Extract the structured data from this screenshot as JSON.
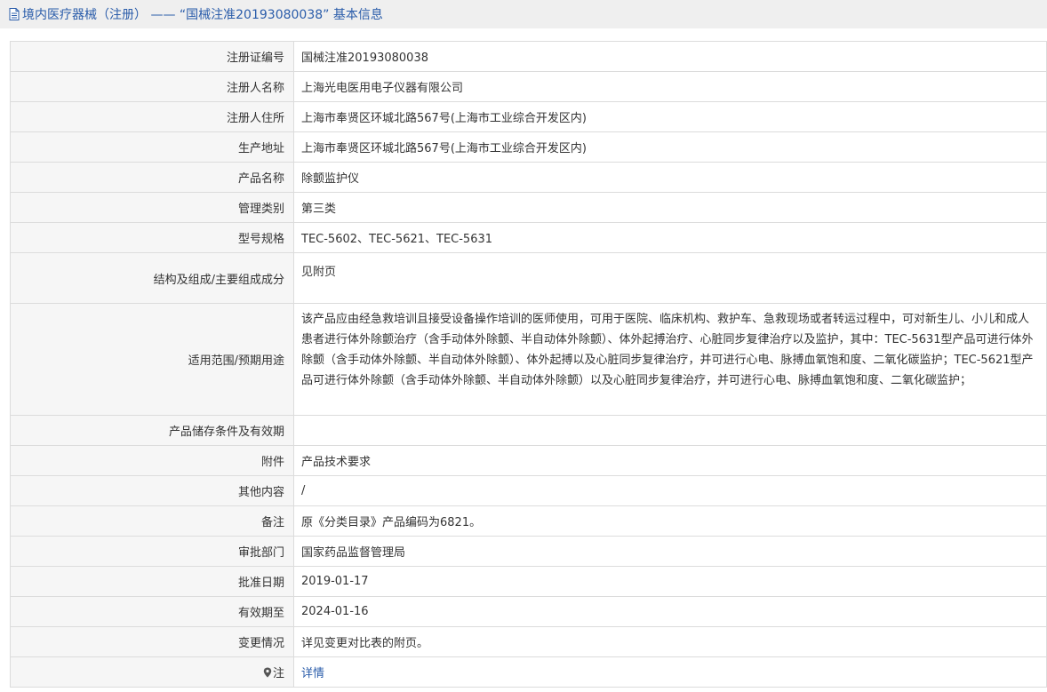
{
  "header": {
    "title": "境内医疗器械（注册） —— “国械注准20193080038” 基本信息"
  },
  "rows": [
    {
      "label": "注册证编号",
      "value": "国械注准20193080038"
    },
    {
      "label": "注册人名称",
      "value": "上海光电医用电子仪器有限公司"
    },
    {
      "label": "注册人住所",
      "value": "上海市奉贤区环城北路567号(上海市工业综合开发区内)"
    },
    {
      "label": "生产地址",
      "value": "上海市奉贤区环城北路567号(上海市工业综合开发区内)"
    },
    {
      "label": "产品名称",
      "value": "除颤监护仪"
    },
    {
      "label": "管理类别",
      "value": "第三类"
    },
    {
      "label": "型号规格",
      "value": "TEC-5602、TEC-5621、TEC-5631"
    },
    {
      "label": "结构及组成/主要组成成分",
      "value": "见附页"
    },
    {
      "label": "适用范围/预期用途",
      "value": "该产品应由经急救培训且接受设备操作培训的医师使用，可用于医院、临床机构、救护车、急救现场或者转运过程中，可对新生儿、小儿和成人患者进行体外除颤治疗（含手动体外除颤、半自动体外除颤）、体外起搏治疗、心脏同步复律治疗以及监护，其中：TEC-5631型产品可进行体外除颤（含手动体外除颤、半自动体外除颤）、体外起搏以及心脏同步复律治疗，并可进行心电、脉搏血氧饱和度、二氧化碳监护；TEC-5621型产品可进行体外除颤（含手动体外除颤、半自动体外除颤）以及心脏同步复律治疗，并可进行心电、脉搏血氧饱和度、二氧化碳监护；"
    },
    {
      "label": "产品储存条件及有效期",
      "value": ""
    },
    {
      "label": "附件",
      "value": "产品技术要求"
    },
    {
      "label": "其他内容",
      "value": "/"
    },
    {
      "label": "备注",
      "value": "原《分类目录》产品编码为6821。"
    },
    {
      "label": "审批部门",
      "value": "国家药品监督管理局"
    },
    {
      "label": "批准日期",
      "value": "2019-01-17"
    },
    {
      "label": "有效期至",
      "value": "2024-01-16"
    },
    {
      "label": "变更情况",
      "value": "详见变更对比表的附页。"
    },
    {
      "label": "注",
      "value": "详情"
    }
  ],
  "colors": {
    "link": "#2a5caa",
    "label_bg": "#f6f6f6",
    "border": "#dcdcdc",
    "header_bg": "#efefef"
  },
  "icons": {
    "header": "document-icon",
    "note": "map-pin-icon"
  }
}
